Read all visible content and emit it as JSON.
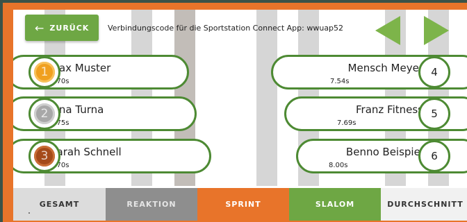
{
  "header": {
    "back_label": "ZURÜCK",
    "back_icon": "arrow-left-icon",
    "connect_text": "Verbindungscode für die Sportstation Connect App: wwuap52",
    "prev_icon": "triangle-left-icon",
    "next_icon": "triangle-right-icon"
  },
  "leaderboard": {
    "left": [
      {
        "rank": "1",
        "name": "Max Muster",
        "time": "5.70s",
        "medal": "gold"
      },
      {
        "rank": "2",
        "name": "Tina Turna",
        "time": "5.75s",
        "medal": "silver"
      },
      {
        "rank": "3",
        "name": "Sarah Schnell",
        "time": "6.70s",
        "medal": "bronze"
      }
    ],
    "right": [
      {
        "rank": "4",
        "name": "Mensch Meyer",
        "time": "7.54s"
      },
      {
        "rank": "5",
        "name": "Franz Fitness",
        "time": "7.69s"
      },
      {
        "rank": "6",
        "name": "Benno Beispiel",
        "time": "8.00s"
      }
    ]
  },
  "tabs": [
    {
      "label": "GESAMT",
      "bg": "#dcdcdc",
      "fg": "#333333"
    },
    {
      "label": "REAKTION",
      "bg": "#8e8e8e",
      "fg": "#e6e6e6"
    },
    {
      "label": "SPRINT",
      "bg": "#e8742a",
      "fg": "#ffffff",
      "active": true
    },
    {
      "label": "SLALOM",
      "bg": "#6ea744",
      "fg": "#ffffff"
    },
    {
      "label": "DURCHSCHNITT",
      "bg": "#f1f1f1",
      "fg": "#333333"
    }
  ],
  "colors": {
    "accent_green": "#6ea744",
    "accent_orange": "#e8742a",
    "outline_green": "#4d8a33"
  }
}
